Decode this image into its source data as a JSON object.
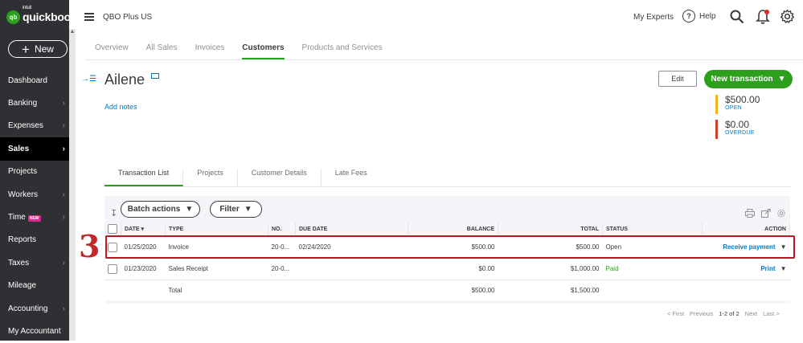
{
  "app": {
    "logo_intuit": "intuit",
    "logo_text": "quickbooks",
    "company": "QBO Plus US"
  },
  "sidebar": {
    "new_label": "New",
    "items": [
      {
        "label": "Dashboard",
        "chev": ""
      },
      {
        "label": "Banking",
        "chev": "›"
      },
      {
        "label": "Expenses",
        "chev": "›"
      },
      {
        "label": "Sales",
        "chev": "›"
      },
      {
        "label": "Projects",
        "chev": ""
      },
      {
        "label": "Workers",
        "chev": "›"
      },
      {
        "label": "Time",
        "chev": "›",
        "badge": "NEW"
      },
      {
        "label": "Reports",
        "chev": ""
      },
      {
        "label": "Taxes",
        "chev": "›"
      },
      {
        "label": "Mileage",
        "chev": ""
      },
      {
        "label": "Accounting",
        "chev": "›"
      },
      {
        "label": "My Accountant",
        "chev": ""
      }
    ]
  },
  "header": {
    "my_experts": "My Experts",
    "help": "Help"
  },
  "tabs": [
    "Overview",
    "All Sales",
    "Invoices",
    "Customers",
    "Products and Services"
  ],
  "customer": {
    "name": "Ailene",
    "add_notes": "Add notes",
    "edit_label": "Edit",
    "new_transaction_label": "New transaction",
    "open_amount": "$500.00",
    "open_label": "OPEN",
    "overdue_amount": "$0.00",
    "overdue_label": "OVERDUE"
  },
  "subtabs": [
    "Transaction List",
    "Projects",
    "Customer Details",
    "Late Fees"
  ],
  "toolbar": {
    "batch_actions": "Batch actions",
    "filter": "Filter"
  },
  "table": {
    "headers": [
      "DATE ▾",
      "TYPE",
      "NO.",
      "DUE DATE",
      "BALANCE",
      "TOTAL",
      "STATUS",
      "ACTION"
    ],
    "rows": [
      {
        "date": "01/25/2020",
        "type": "Invoice",
        "no": "20-0...",
        "due": "02/24/2020",
        "balance": "$500.00",
        "total": "$500.00",
        "status": "Open",
        "action": "Receive payment"
      },
      {
        "date": "01/23/2020",
        "type": "Sales Receipt",
        "no": "20-0...",
        "due": "",
        "balance": "$0.00",
        "total": "$1,000.00",
        "status": "Paid",
        "action": "Print"
      }
    ],
    "total_label": "Total",
    "total_balance": "$500.00",
    "total_total": "$1,500.00"
  },
  "pager": {
    "first": "< First",
    "previous": "Previous",
    "range": "1-2 of 2",
    "next": "Next",
    "last": "Last >"
  },
  "annotation": {
    "step": "3"
  },
  "colors": {
    "brand_green": "#2ca01c",
    "link_blue": "#0077c5",
    "open_bar": "#f2b21b",
    "overdue_bar": "#c9422e",
    "highlight_red": "#b51a1e"
  }
}
